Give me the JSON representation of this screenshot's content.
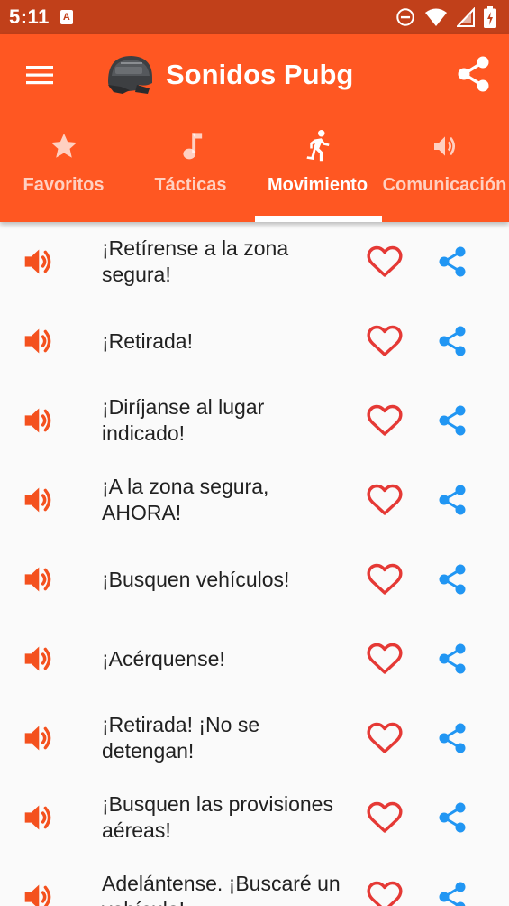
{
  "status_bar": {
    "time": "5:11",
    "notification_icon": "a-icon",
    "icons": [
      "do-not-disturb-icon",
      "wifi-icon",
      "signal-icon",
      "battery-icon"
    ]
  },
  "app_bar": {
    "title": "Sonidos Pubg",
    "menu_icon": "hamburger-menu-icon",
    "logo": "helmet-logo",
    "share_icon": "share-icon",
    "color": "#ff5722"
  },
  "tabs": [
    {
      "label": "Favoritos",
      "icon": "star-icon",
      "active": false
    },
    {
      "label": "Tácticas",
      "icon": "music-note-icon",
      "active": false
    },
    {
      "label": "Movimiento",
      "icon": "running-person-icon",
      "active": true
    },
    {
      "label": "Comunicación",
      "icon": "speaker-icon",
      "active": false
    }
  ],
  "sounds": [
    {
      "text": "¡Retírense a la zona segura!"
    },
    {
      "text": "¡Retirada!"
    },
    {
      "text": "¡Diríjanse al lugar indicado!"
    },
    {
      "text": "¡A la zona segura, AHORA!"
    },
    {
      "text": "¡Busquen vehículos!"
    },
    {
      "text": "¡Acérquense!"
    },
    {
      "text": "¡Retirada! ¡No se detengan!"
    },
    {
      "text": "¡Busquen las provisiones aéreas!"
    },
    {
      "text": "Adelántense. ¡Buscaré un vehículo!"
    }
  ],
  "colors": {
    "status_bar": "#c1401a",
    "play_icon": "#f4511e",
    "favorite_icon": "#e53935",
    "share_icon": "#2196f3"
  }
}
